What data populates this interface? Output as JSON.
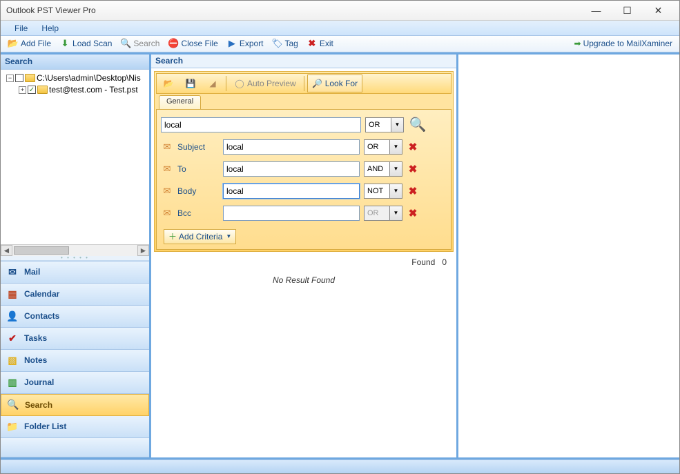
{
  "window": {
    "title": "Outlook PST Viewer Pro"
  },
  "menu": {
    "file": "File",
    "help": "Help"
  },
  "toolbar": {
    "add_file": "Add File",
    "load_scan": "Load Scan",
    "search": "Search",
    "close_file": "Close File",
    "export": "Export",
    "tag": "Tag",
    "exit": "Exit",
    "upgrade": "Upgrade to MailXaminer"
  },
  "sidebar": {
    "header": "Search",
    "tree": {
      "root_label": "C:\\Users\\admin\\Desktop\\Nis",
      "child_label": "test@test.com - Test.pst"
    },
    "nav": [
      {
        "label": "Mail"
      },
      {
        "label": "Calendar"
      },
      {
        "label": "Contacts"
      },
      {
        "label": "Tasks"
      },
      {
        "label": "Notes"
      },
      {
        "label": "Journal"
      },
      {
        "label": "Search"
      },
      {
        "label": "Folder List"
      }
    ]
  },
  "center": {
    "header": "Search",
    "toolbar": {
      "auto_preview": "Auto Preview",
      "look_for": "Look For"
    },
    "tab_general": "General",
    "main_search": {
      "value": "local",
      "operator": "OR"
    },
    "criteria": [
      {
        "field": "Subject",
        "value": "local",
        "operator": "OR"
      },
      {
        "field": "To",
        "value": "local",
        "operator": "AND"
      },
      {
        "field": "Body",
        "value": "local",
        "operator": "NOT"
      },
      {
        "field": "Bcc",
        "value": "",
        "operator": "OR"
      }
    ],
    "add_criteria": "Add Criteria",
    "found_label": "Found",
    "found_count": "0",
    "no_result": "No Result Found"
  }
}
